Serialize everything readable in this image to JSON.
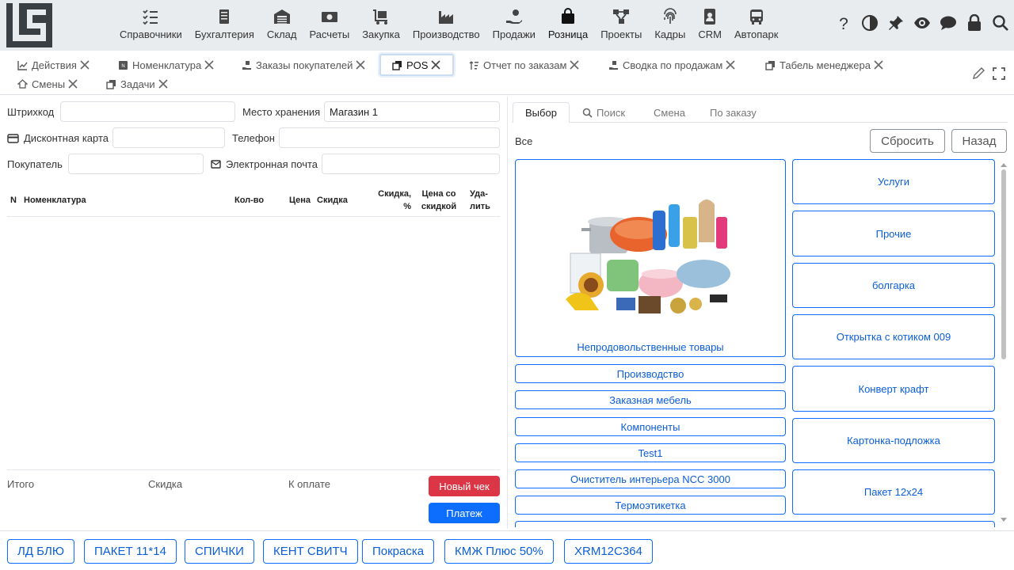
{
  "topbar": {
    "modules": [
      {
        "label": "Справочники",
        "icon": "list-check-icon"
      },
      {
        "label": "Бухгалтерия",
        "icon": "ledger-icon"
      },
      {
        "label": "Склад",
        "icon": "warehouse-icon"
      },
      {
        "label": "Расчеты",
        "icon": "money-icon"
      },
      {
        "label": "Закупка",
        "icon": "cart-dolly-icon"
      },
      {
        "label": "Производство",
        "icon": "factory-icon"
      },
      {
        "label": "Продажи",
        "icon": "hand-coin-icon"
      },
      {
        "label": "Розница",
        "icon": "shopping-bag-icon"
      },
      {
        "label": "Проекты",
        "icon": "diagram-icon"
      },
      {
        "label": "Кадры",
        "icon": "fingerprint-icon"
      },
      {
        "label": "CRM",
        "icon": "contact-card-icon"
      },
      {
        "label": "Автопарк",
        "icon": "bus-icon"
      }
    ],
    "active_module": "Розница",
    "tools": [
      "help-icon",
      "contrast-icon",
      "pin-icon",
      "eye-icon",
      "chat-icon",
      "lock-icon",
      "search-icon"
    ]
  },
  "tabs": [
    {
      "label": "Действия",
      "icon": "chart-line-icon"
    },
    {
      "label": "Номенклатура",
      "icon": "nomenclature-icon"
    },
    {
      "label": "Заказы покупателей",
      "icon": "hand-box-icon"
    },
    {
      "label": "POS",
      "icon": "copy-icon",
      "active": true
    },
    {
      "label": "Отчет по заказам",
      "icon": "sort-icon"
    },
    {
      "label": "Сводка по продажам",
      "icon": "hand-box-icon"
    },
    {
      "label": "Табель менеджера",
      "icon": "copy-icon"
    },
    {
      "label": "Смены",
      "icon": "home-up-icon"
    },
    {
      "label": "Задачи",
      "icon": "copy-icon"
    }
  ],
  "form": {
    "barcode_label": "Штрихкод",
    "barcode_value": "",
    "storage_label": "Место хранения",
    "storage_value": "Магазин 1",
    "discount_card_label": "Дисконтная карта",
    "discount_card_value": "",
    "phone_label": "Телефон",
    "phone_value": "",
    "buyer_label": "Покупатель",
    "buyer_value": "",
    "email_label": "Электронная почта",
    "email_value": ""
  },
  "grid": {
    "columns": [
      "N",
      "Номенклатура",
      "Кол-во",
      "Цена",
      "Скидка",
      "Скидка, %",
      "Цена со скидкой",
      "Уда-лить"
    ],
    "col_discount_pct_1": "Скидка,",
    "col_discount_pct_2": "%",
    "col_price_disc_1": "Цена со",
    "col_price_disc_2": "скидкой",
    "col_delete_1": "Уда-",
    "col_delete_2": "лить",
    "rows": []
  },
  "totals": {
    "total_label": "Итого",
    "discount_label": "Скидка",
    "to_pay_label": "К оплате",
    "new_check_label": "Новый чек",
    "payment_label": "Платеж"
  },
  "right_panel": {
    "tabs": [
      "Выбор",
      "Поиск",
      "Смена",
      "По заказу"
    ],
    "active_tab": "Выбор",
    "breadcrumb": "Все",
    "reset_label": "Сбросить",
    "back_label": "Назад",
    "featured_category": "Непродовольственные товары",
    "left_categories": [
      "Производство",
      "Заказная мебель",
      "Компоненты",
      "Test1",
      "Очиститель интерьера NCC 3000",
      "Термоэтикетка"
    ],
    "right_categories": [
      "Услуги",
      "Прочие",
      "болгарка",
      "Открытка с котиком 009",
      "Конверт крафт",
      "Картонка-подложка",
      "Пакет 12х24"
    ]
  },
  "quick_buttons": [
    "ЛД БЛЮ",
    "ПАКЕТ 11*14",
    "СПИЧКИ",
    "КЕНТ СВИТЧ",
    "Покраска",
    "КМЖ Плюс 50%",
    "XRM12C364"
  ],
  "colors": {
    "topbar_bg": "#e9ecef",
    "primary": "#0d6efd",
    "danger": "#dc3545",
    "border": "#dee2e6"
  }
}
